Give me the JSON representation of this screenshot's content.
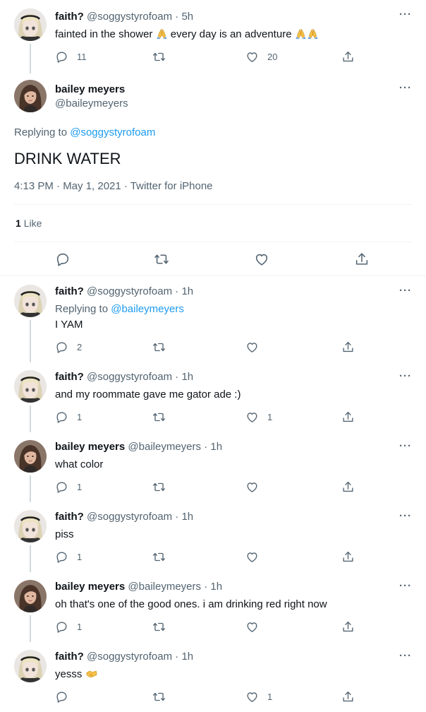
{
  "colors": {
    "accent": "#1d9bf0",
    "muted": "#536471",
    "text": "#0f1419",
    "border": "#eff3f4"
  },
  "icons": {
    "reply": "reply-icon",
    "retweet": "retweet-icon",
    "like": "heart-icon",
    "share": "share-icon",
    "more": "more-icon"
  },
  "parent": {
    "name": "faith?",
    "handle": "@soggystyrofoam",
    "time": "· 5h",
    "text_a": "fainted in the shower",
    "text_b": "every day is an adventure",
    "emoji_a": "folded-hands-emoji",
    "emoji_b": "folded-hands-emoji-x2",
    "reply_count": "11",
    "like_count": "20"
  },
  "main": {
    "name": "bailey meyers",
    "handle": "@baileymeyers",
    "replying_prefix": "Replying to",
    "replying_handle": "@soggystyrofoam",
    "text": "DRINK WATER",
    "meta": "4:13 PM · May 1, 2021 · Twitter for iPhone",
    "likes_count": "1",
    "likes_label": "Like"
  },
  "replies": [
    {
      "name": "faith?",
      "handle": "@soggystyrofoam",
      "time": "· 1h",
      "replying_prefix": "Replying to",
      "replying_handle": "@baileymeyers",
      "text": "I YAM",
      "reply_count": "2",
      "like_count": ""
    },
    {
      "name": "faith?",
      "handle": "@soggystyrofoam",
      "time": "· 1h",
      "text": "and my roommate gave me gator ade :)",
      "reply_count": "1",
      "like_count": "1"
    },
    {
      "name": "bailey meyers",
      "handle": "@baileymeyers",
      "time": "· 1h",
      "text": "what color",
      "reply_count": "1",
      "like_count": ""
    },
    {
      "name": "faith?",
      "handle": "@soggystyrofoam",
      "time": "· 1h",
      "text": "piss",
      "reply_count": "1",
      "like_count": ""
    },
    {
      "name": "bailey meyers",
      "handle": "@baileymeyers",
      "time": "· 1h",
      "text": "oh that's one of the good ones. i am drinking red right now",
      "reply_count": "1",
      "like_count": ""
    },
    {
      "name": "faith?",
      "handle": "@soggystyrofoam",
      "time": "· 1h",
      "text": "yesss",
      "emoji": "handshake-emoji",
      "reply_count": "",
      "like_count": "1"
    }
  ]
}
